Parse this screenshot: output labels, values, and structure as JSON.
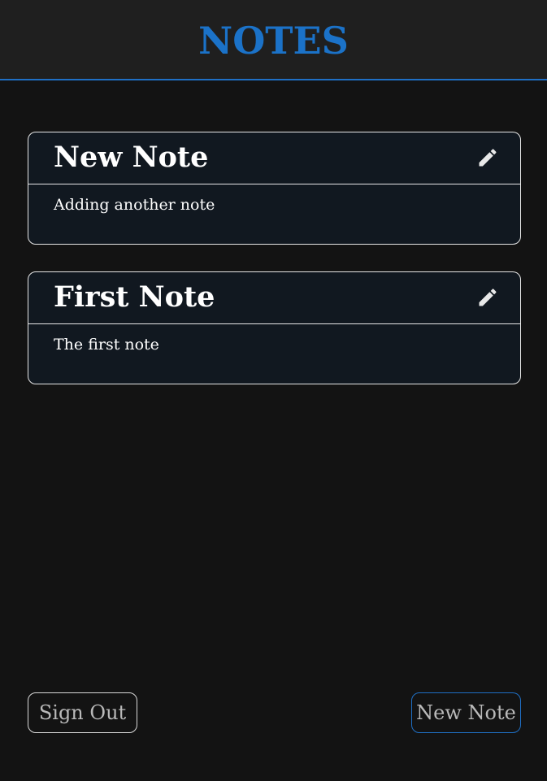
{
  "app": {
    "title": "NOTES",
    "accent_color": "#1b72c8",
    "background_color": "#131313"
  },
  "notes": [
    {
      "title": "New Note",
      "body": "Adding another note",
      "edit_icon": "pencil-icon"
    },
    {
      "title": "First Note",
      "body": "The first note",
      "edit_icon": "pencil-icon"
    }
  ],
  "footer": {
    "sign_out_label": "Sign Out",
    "new_note_label": "New Note"
  }
}
